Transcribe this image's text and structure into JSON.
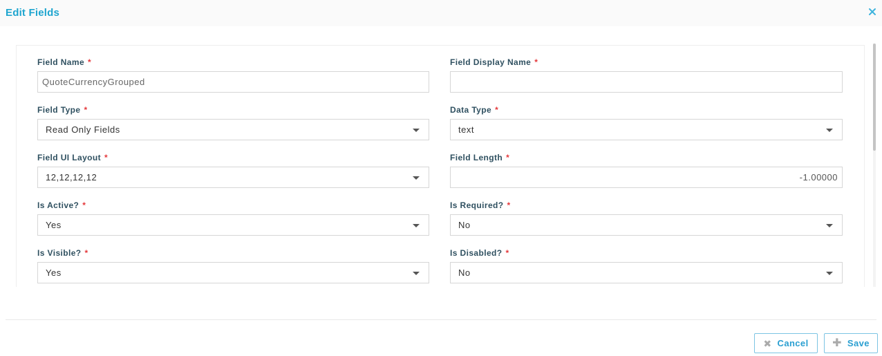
{
  "dialog": {
    "title": "Edit Fields",
    "accent_color": "#1ea5cf",
    "required_color": "#e4393c"
  },
  "form": {
    "field_name": {
      "label": "Field Name",
      "required_mark": "*",
      "value": "QuoteCurrencyGrouped"
    },
    "field_display_name": {
      "label": "Field Display Name",
      "required_mark": "*",
      "value": ""
    },
    "field_type": {
      "label": "Field Type",
      "required_mark": "*",
      "value": "Read Only Fields"
    },
    "data_type": {
      "label": "Data Type",
      "required_mark": "*",
      "value": "text"
    },
    "field_ui_layout": {
      "label": "Field UI Layout",
      "required_mark": "*",
      "value": "12,12,12,12"
    },
    "field_length": {
      "label": "Field Length",
      "required_mark": "*",
      "value": "-1.00000"
    },
    "is_active": {
      "label": "Is Active?",
      "required_mark": "*",
      "value": "Yes"
    },
    "is_required": {
      "label": "Is Required?",
      "required_mark": "*",
      "value": "No"
    },
    "is_visible": {
      "label": "Is Visible?",
      "required_mark": "*",
      "value": "Yes"
    },
    "is_disabled": {
      "label": "Is Disabled?",
      "required_mark": "*",
      "value": "No"
    }
  },
  "footer": {
    "cancel_label": "Cancel",
    "cancel_icon": "x-icon",
    "save_label": "Save",
    "save_icon": "plus-icon"
  }
}
